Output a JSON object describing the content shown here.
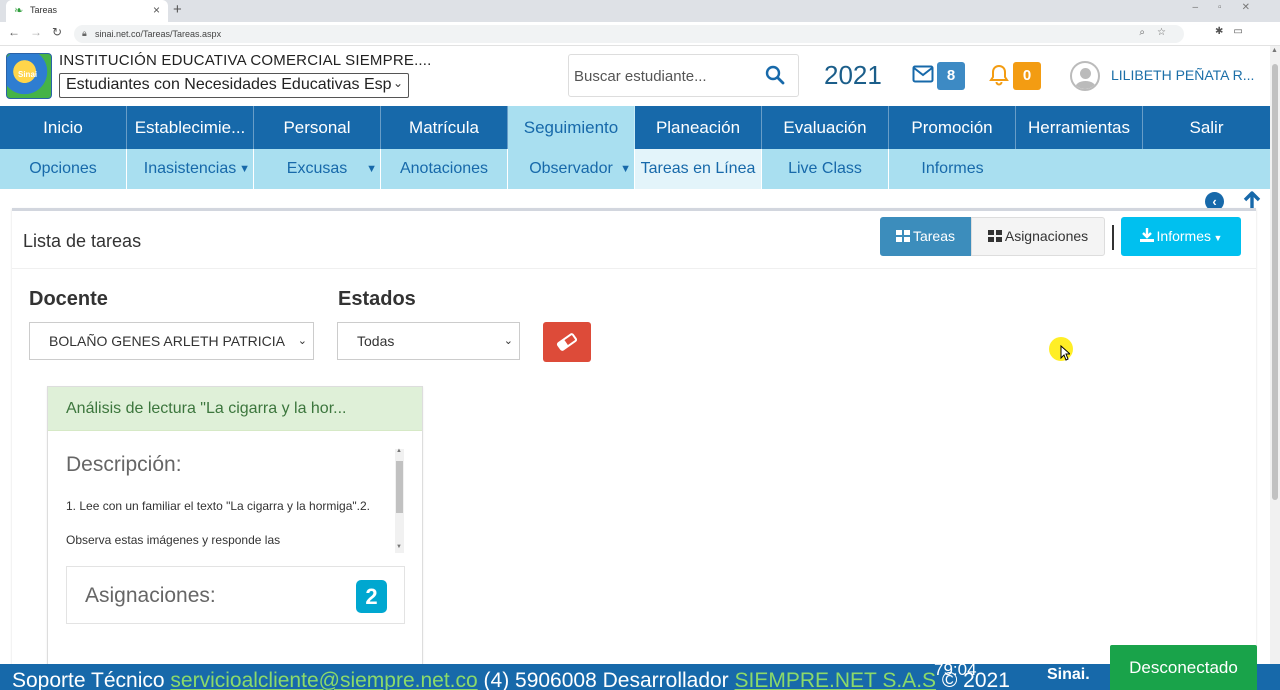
{
  "browser": {
    "tab_title": "Tareas",
    "url": "sinai.net.co/Tareas/Tareas.aspx"
  },
  "header": {
    "institution": "INSTITUCIÓN EDUCATIVA COMERCIAL SIEMPRE....",
    "group": "Estudiantes con Necesidades Educativas Esp",
    "search_placeholder": "Buscar estudiante...",
    "year": "2021",
    "messages_count": "8",
    "notifications_count": "0",
    "user_name": "LILIBETH PEÑATA R...",
    "logo_text": "Sinai"
  },
  "main_nav": [
    {
      "label": "Inicio"
    },
    {
      "label": "Establecimie..."
    },
    {
      "label": "Personal"
    },
    {
      "label": "Matrícula"
    },
    {
      "label": "Seguimiento",
      "active": true
    },
    {
      "label": "Planeación"
    },
    {
      "label": "Evaluación"
    },
    {
      "label": "Promoción"
    },
    {
      "label": "Herramientas"
    },
    {
      "label": "Salir"
    }
  ],
  "sub_nav": [
    {
      "label": "Opciones"
    },
    {
      "label": "Inasistencias",
      "dropdown": true
    },
    {
      "label": "Excusas",
      "dropdown": true
    },
    {
      "label": "Anotaciones"
    },
    {
      "label": "Observador",
      "dropdown": true
    },
    {
      "label": "Tareas en Línea",
      "active": true
    },
    {
      "label": "Live Class"
    },
    {
      "label": "Informes"
    }
  ],
  "panel": {
    "title": "Lista de tareas",
    "btn_tareas": "Tareas",
    "btn_asignaciones": "Asignaciones",
    "btn_informes": "Informes",
    "docente_label": "Docente",
    "docente_value": "BOLAÑO GENES ARLETH PATRICIA",
    "estados_label": "Estados",
    "estados_value": "Todas"
  },
  "task_card": {
    "title": "Análisis de lectura \"La cigarra y la hor...",
    "description_label": "Descripción:",
    "description_text": "1. Lee con un familiar el texto \"La cigarra y la hormiga\".2. Observa estas imágenes y responde las",
    "assignments_label": "Asignaciones:",
    "assignments_count": "2"
  },
  "footer": {
    "support_label": "Soporte Técnico",
    "support_email": "servicioalcliente@siempre.net.co",
    "phone": "(4) 5906008",
    "developer_label": "Desarrollador",
    "developer_name": "SIEMPRE.NET S.A.S",
    "copyright": "© 2021",
    "time": "79:04",
    "logo": "Sinai.",
    "status": "Desconectado"
  },
  "colors": {
    "nav_blue": "#1769aa",
    "subnav_blue": "#a9dff0",
    "primary_button": "#3c8dbc",
    "info_button": "#00c0ef",
    "danger_button": "#dd4b39",
    "success_header": "#dff0d8",
    "status_green": "#19a34a"
  },
  "icons": {
    "search": "magnifier-icon",
    "mail": "envelope-icon",
    "bell": "bell-icon",
    "back": "chevron-left-circle-icon",
    "up": "arrow-up-icon",
    "eraser": "eraser-icon",
    "download": "download-icon"
  }
}
